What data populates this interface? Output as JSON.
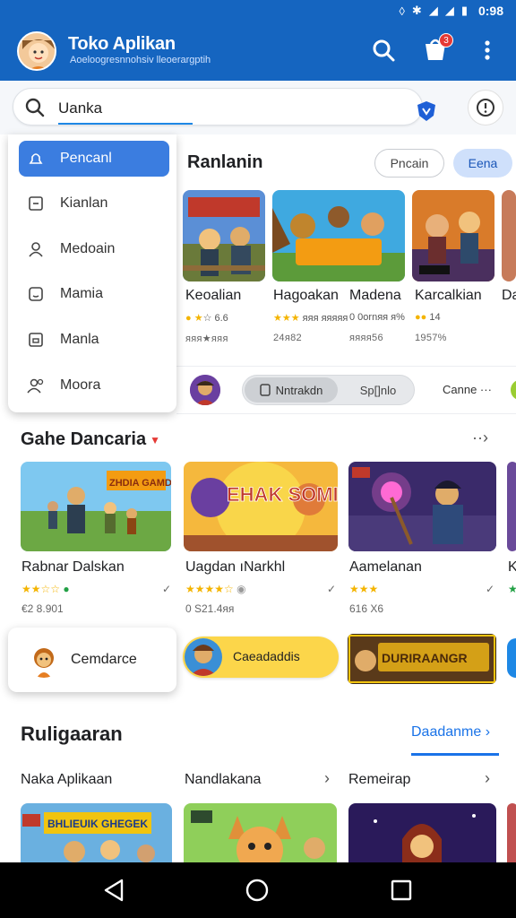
{
  "status_bar": {
    "time": "0:98"
  },
  "app_bar": {
    "title": "Toko Aplikan",
    "subtitle": "Aoeloogresnnohsiv lleoerargptih",
    "cart_badge": "3"
  },
  "search": {
    "value": "Uanka"
  },
  "side_menu": {
    "items": [
      {
        "label": "Pencanl",
        "icon": "bell-icon"
      },
      {
        "label": "Kianlan",
        "icon": "calendar-icon"
      },
      {
        "label": "Medoain",
        "icon": "user-icon"
      },
      {
        "label": "Mamia",
        "icon": "smile-icon"
      },
      {
        "label": "Manla",
        "icon": "box-icon"
      },
      {
        "label": "Moora",
        "icon": "group-icon"
      }
    ]
  },
  "section1": {
    "title": "Ranlanin",
    "chips": [
      "Pncain",
      "Eena"
    ],
    "cards": [
      {
        "name": "Keoalian",
        "rating": "☆ 6.6",
        "stat": "ᴙᴙᴙ★ᴙᴙᴙ"
      },
      {
        "name": "Hagoakan",
        "rating": "ᴙᴙᴙ ᴙᴙᴙᴙᴙ",
        "stat": "24ᴙ82"
      },
      {
        "name": "Madena",
        "rating": "0 0ornᴙᴙ ᴙ%",
        "stat": "ᴙᴙᴙᴙ56"
      },
      {
        "name": "Karcalkian",
        "rating": "14",
        "stat": "1957%"
      },
      {
        "name": "Da",
        "rating": "",
        "stat": ""
      }
    ]
  },
  "strip": {
    "segment_a": "Nntrakdn",
    "segment_b": "Sp[]nlo",
    "more": "Canne ···"
  },
  "section2": {
    "title": "Gahe Dancaria",
    "more": "··›",
    "cards": [
      {
        "name": "Rabnar Dalskan",
        "stars": "★★☆☆",
        "stat": "€2 8.901",
        "art_text": "ZHDIA GAMDLEN"
      },
      {
        "name": "Uagdan ıNarkhl",
        "stars": "★★★★☆",
        "stat": "0 S21.4ᴙᴙ",
        "art_text": "EHAK SOMIS"
      },
      {
        "name": "Aamelanan",
        "stars": "★★★",
        "stat": "616 X6",
        "art_text": ""
      },
      {
        "name": "K",
        "stars": "",
        "stat": "",
        "art_text": ""
      }
    ]
  },
  "promos": {
    "popup_label": "Cemdarce",
    "pill_label": "Caeadaddis",
    "banner_text": "DURIRAANGR"
  },
  "section3": {
    "title": "Ruligaaran",
    "link": "Daadanme ›",
    "tabs": [
      "Naka Aplikaan",
      "Nandlakana",
      "Remeirap"
    ],
    "art_text": "BHLIEUIK GHEGEK"
  },
  "colors": {
    "primary": "#1565c0",
    "accent": "#1a73e8",
    "star": "#f4b400",
    "active_menu": "#3b7de0"
  }
}
